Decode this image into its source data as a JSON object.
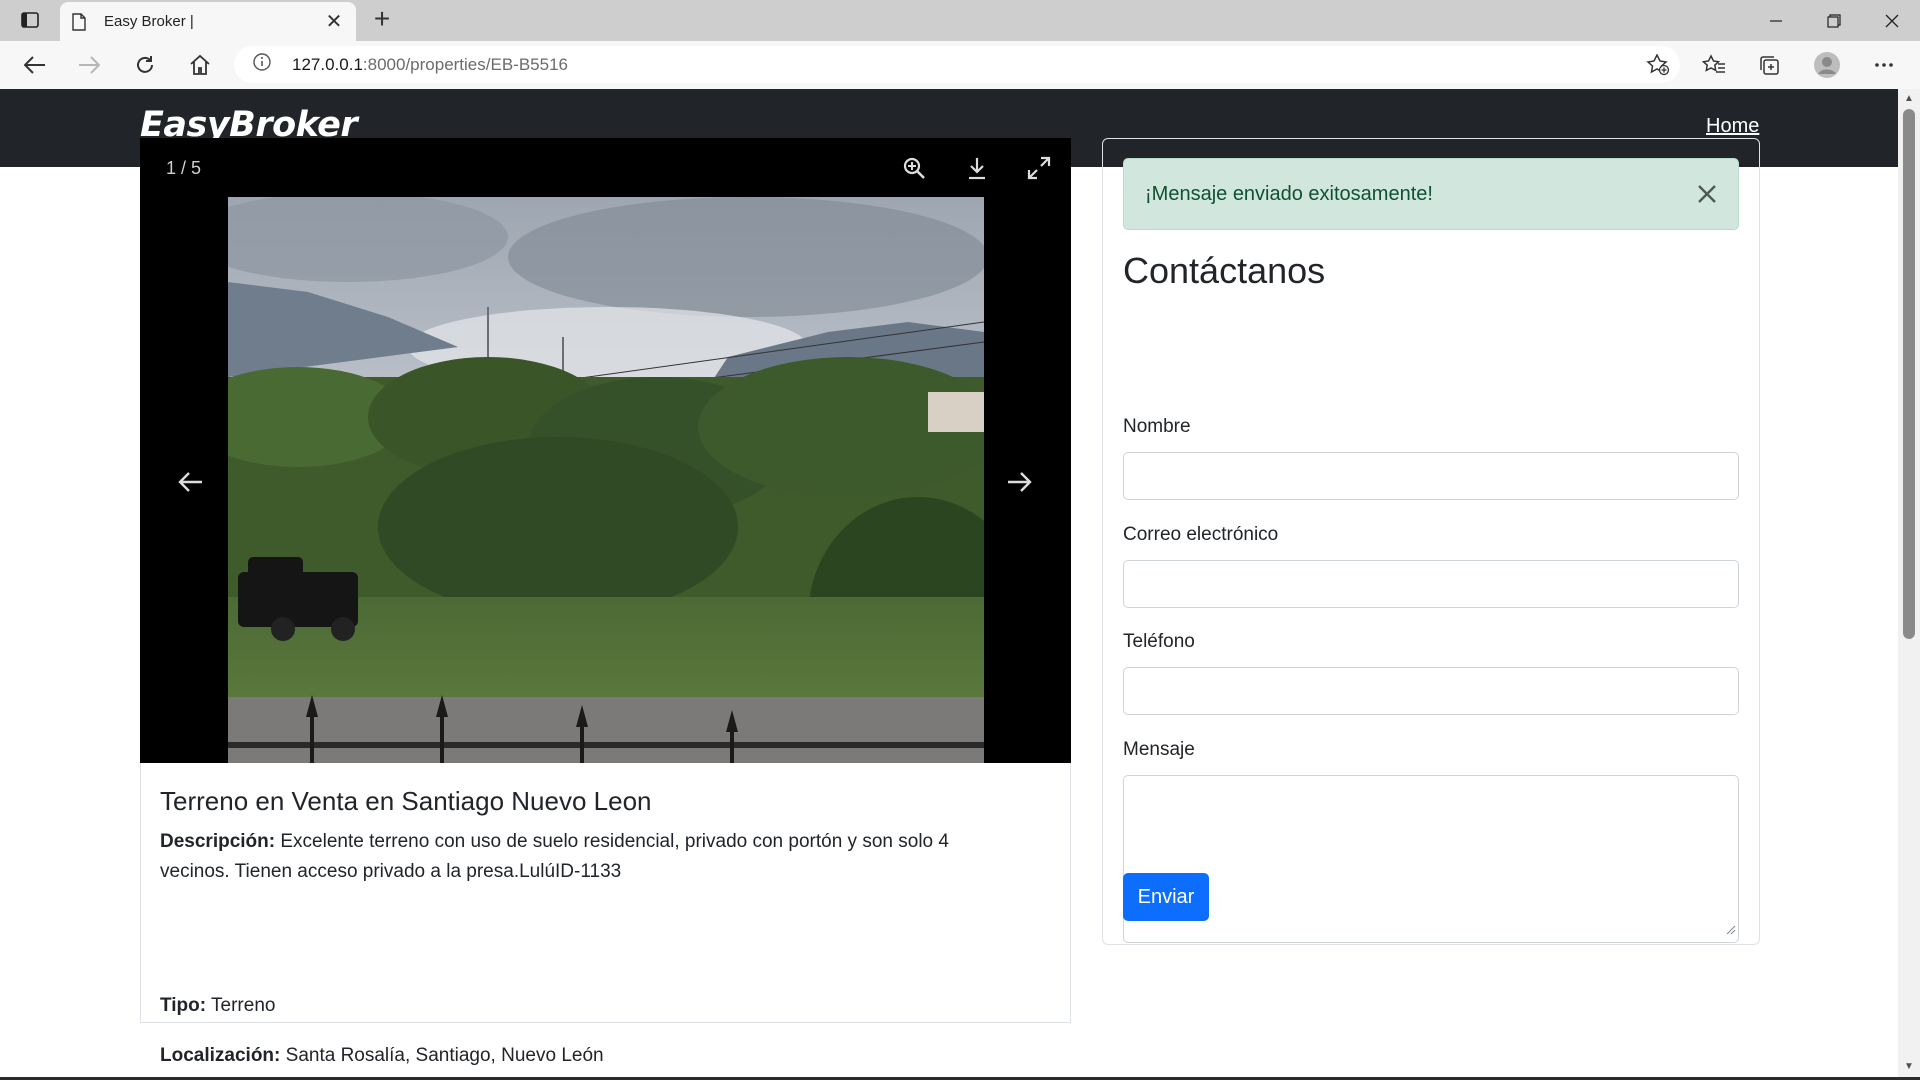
{
  "browser": {
    "tab_title": "Easy Broker |",
    "url_host": "127.0.0.1",
    "url_path": ":8000/properties/EB-B5516",
    "icons": [
      "tab-actions-icon",
      "page-icon",
      "close-icon",
      "plus-icon",
      "minimize-icon",
      "restore-icon",
      "close-window-icon",
      "back-icon",
      "forward-icon",
      "refresh-icon",
      "home-icon",
      "info-icon",
      "add-favorite-icon",
      "favorites-icon",
      "collections-icon",
      "profile-icon",
      "more-icon"
    ]
  },
  "navbar": {
    "brand": "EasyBroker",
    "home_link": "Home"
  },
  "gallery": {
    "counter": "1 / 5",
    "icons": [
      "zoom-in-icon",
      "download-icon",
      "fullscreen-icon",
      "arrow-left-icon",
      "arrow-right-icon"
    ]
  },
  "property": {
    "title": "Terreno en Venta en Santiago Nuevo Leon",
    "description_label": "Descripción:",
    "description_text": "Excelente terreno con uso de suelo residencial, privado con portón y son solo 4 vecinos. Tienen acceso privado a la presa.LulúID-1133",
    "type_label": "Tipo:",
    "type_value": "Terreno",
    "location_label": "Localización:",
    "location_value": "Santa Rosalía, Santiago, Nuevo León"
  },
  "contact": {
    "alert": "¡Mensaje enviado exitosamente!",
    "title": "Contáctanos",
    "name_label": "Nombre",
    "name_value": "",
    "email_label": "Correo electrónico",
    "email_value": "",
    "phone_label": "Teléfono",
    "phone_value": "",
    "message_label": "Mensaje",
    "message_value": "",
    "submit": "Enviar"
  },
  "colors": {
    "navbar_bg": "#212529",
    "alert_bg": "#d1e7dd",
    "alert_text": "#0f5132",
    "primary": "#0d6efd"
  }
}
